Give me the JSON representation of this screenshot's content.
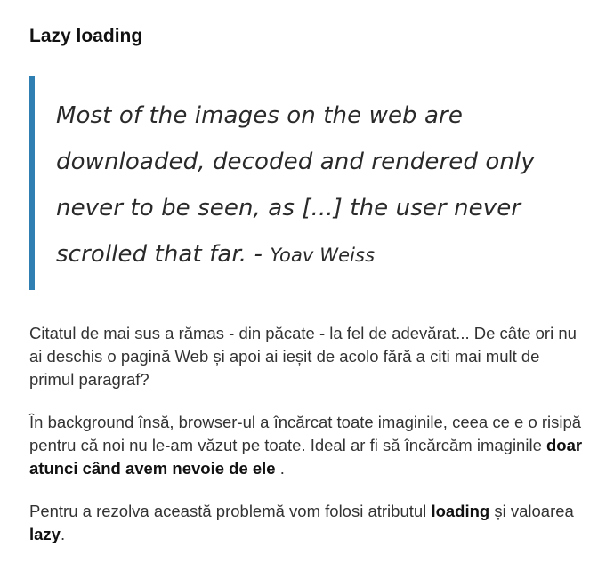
{
  "heading": "Lazy loading",
  "quote": {
    "text": "Most of the images on the web are downloaded, decoded and rendered only never to be seen, as [...] the user never scrolled that far.",
    "separator": " - ",
    "author": "Yoav Weiss",
    "border_color": "#2f7fb3"
  },
  "paragraphs": {
    "p1": "Citatul de mai sus a rămas - din păcate - la fel de adevărat... De câte ori nu ai deschis o pagină Web și apoi ai ieșit de acolo fără a citi mai mult de primul paragraf?",
    "p2": {
      "before": "În background însă, browser-ul a încărcat toate imaginile, ceea ce e o risipă pentru că noi nu le-am văzut pe toate. Ideal ar fi să încărcăm imaginile ",
      "bold": "doar atunci când avem nevoie de ele",
      "after": " ."
    },
    "p3": {
      "before": "Pentru a rezolva această problemă vom folosi atributul ",
      "bold1": "loading",
      "middle": " și valoarea ",
      "bold2": "lazy",
      "after": "."
    }
  }
}
